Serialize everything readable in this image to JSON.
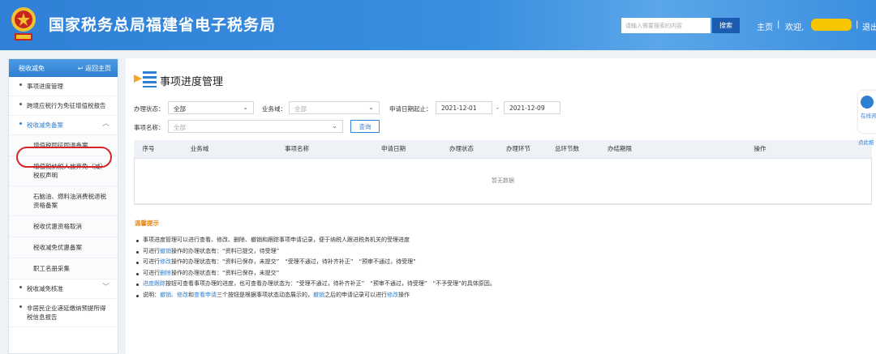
{
  "header": {
    "title": "国家税务总局福建省电子税务局",
    "search_placeholder": "请输入需要搜索的内容",
    "search_label": "搜索",
    "home_label": "主页",
    "welcome_label": "欢迎,",
    "logout_label": "退出",
    "accent": "#2f80d6"
  },
  "sidebar": {
    "title": "税收减免",
    "back_label": "返回主页",
    "items": [
      {
        "label": "事项进度管理"
      },
      {
        "label": "跨境应税行为免征增值税报告"
      },
      {
        "label": "税收减免备案"
      },
      {
        "label": "税收减免核准"
      },
      {
        "label": "非居民企业递延缴纳预提所得税信息报告"
      }
    ],
    "sub_items": [
      {
        "label": "增值税即征即退备案"
      },
      {
        "label": "增值税纳税人放弃免（减）税权声明"
      },
      {
        "label": "石脑油、燃料油消费税退税资格备案"
      },
      {
        "label": "税收优惠资格取消"
      },
      {
        "label": "税收减免优惠备案"
      },
      {
        "label": "职工名册采集"
      }
    ]
  },
  "main": {
    "title": "事项进度管理",
    "filters": {
      "status_label": "办理状态：",
      "status_value": "全部",
      "domain_label": "业务域：",
      "domain_value": "全部",
      "date_label": "申请日期起止：",
      "date_from": "2021-12-01",
      "date_sep": "-",
      "date_to": "2021-12-09",
      "name_label": "事项名称：",
      "name_value": "全部",
      "query_label": "查询"
    },
    "table": {
      "columns": [
        "序号",
        "业务域",
        "事项名称",
        "申请日期",
        "办理状态",
        "办理环节",
        "总环节数",
        "办结期限",
        "操作"
      ],
      "empty_text": "暂无数据"
    },
    "tips_title": "温馨提示",
    "tips": [
      {
        "parts": [
          {
            "t": "事项进度管理可以进行查看、修改、删除、撤销和跟踪事项申请记录，便于纳税人跟进税务机关的受理进度"
          }
        ]
      },
      {
        "parts": [
          {
            "t": "可进行"
          },
          {
            "t": "撤销",
            "blue": true
          },
          {
            "t": "操作的办理状态有：“资料已提交，待受理”"
          }
        ]
      },
      {
        "parts": [
          {
            "t": "可进行"
          },
          {
            "t": "修改",
            "blue": true
          },
          {
            "t": "操作的办理状态有：“资料已保存，未提交”　“受理不通过，待补齐补正”　“预审不通过，待受理”"
          }
        ]
      },
      {
        "parts": [
          {
            "t": "可进行"
          },
          {
            "t": "删除",
            "blue": true
          },
          {
            "t": "操作的办理状态有：“资料已保存，未提交”"
          }
        ]
      },
      {
        "parts": [
          {
            "t": "进度跟踪",
            "blue": true
          },
          {
            "t": "按钮可查看事项办理的进度，也可查看办理状态为：“受理不通过，待补齐补正”　“预审不通过，待受理”　“不予受理”的具体原因。"
          }
        ]
      },
      {
        "parts": [
          {
            "t": "说明："
          },
          {
            "t": "撤销、修改",
            "blue": true
          },
          {
            "t": "和"
          },
          {
            "t": "查看申请",
            "blue": true
          },
          {
            "t": "三个按钮是根据事项状态动态展示的，"
          },
          {
            "t": "撤销",
            "blue": true
          },
          {
            "t": "之后的申请记录可以进行"
          },
          {
            "t": "修改",
            "blue": true
          },
          {
            "t": "操作"
          }
        ]
      }
    ]
  },
  "float": {
    "label": "在线咨询",
    "more_label": "点此按"
  }
}
